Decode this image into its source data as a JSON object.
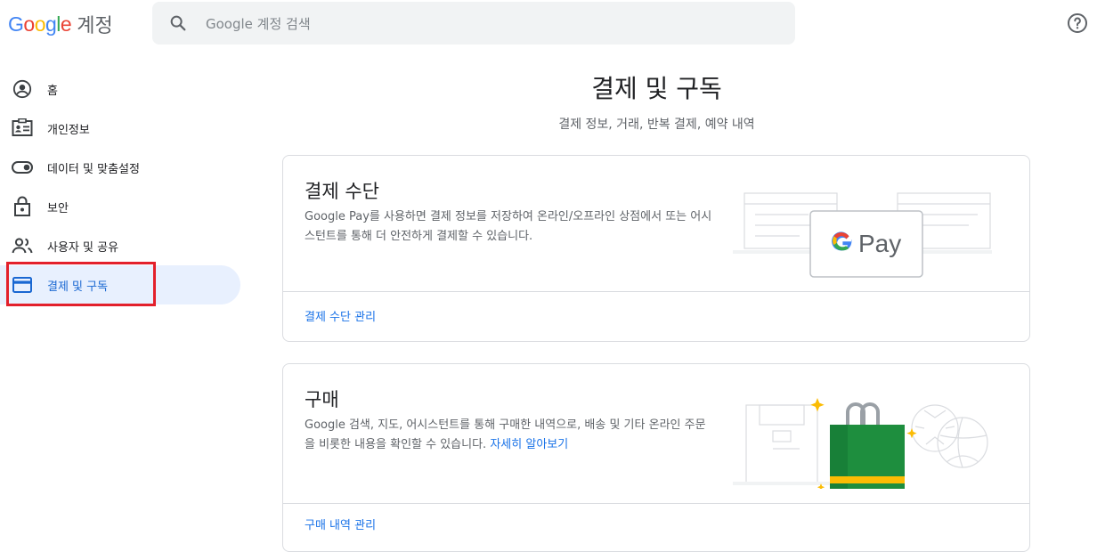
{
  "header": {
    "logo_google": "Google",
    "logo_suffix": "계정",
    "search_placeholder": "Google 계정 검색"
  },
  "sidebar": {
    "items": [
      {
        "label": "홈",
        "icon": "account-circle-icon"
      },
      {
        "label": "개인정보",
        "icon": "id-card-icon"
      },
      {
        "label": "데이터 및 맞춤설정",
        "icon": "toggle-icon"
      },
      {
        "label": "보안",
        "icon": "lock-icon"
      },
      {
        "label": "사용자 및 공유",
        "icon": "people-icon"
      },
      {
        "label": "결제 및 구독",
        "icon": "credit-card-icon",
        "active": true
      }
    ]
  },
  "main": {
    "title": "결제 및 구독",
    "subtitle": "결제 정보, 거래, 반복 결제, 예약 내역",
    "payment_card": {
      "heading": "결제 수단",
      "description": "Google Pay를 사용하면 결제 정보를 저장하여 온라인/오프라인 상점에서 또는 어시스턴트를 통해 더 안전하게 결제할 수 있습니다.",
      "link": "결제 수단 관리",
      "gpay_label": "Pay"
    },
    "purchase_card": {
      "heading": "구매",
      "description": "Google 검색, 지도, 어시스턴트를 통해 구매한 내역으로, 배송 및 기타 온라인 주문을 비롯한 내용을 확인할 수 있습니다.",
      "inline_link": "자세히 알아보기",
      "link": "구매 내역 관리"
    }
  },
  "colors": {
    "active_bg": "#e8f0fe",
    "active_text": "#1967d2",
    "link": "#1a73e8",
    "highlight_border": "#e3202b"
  }
}
